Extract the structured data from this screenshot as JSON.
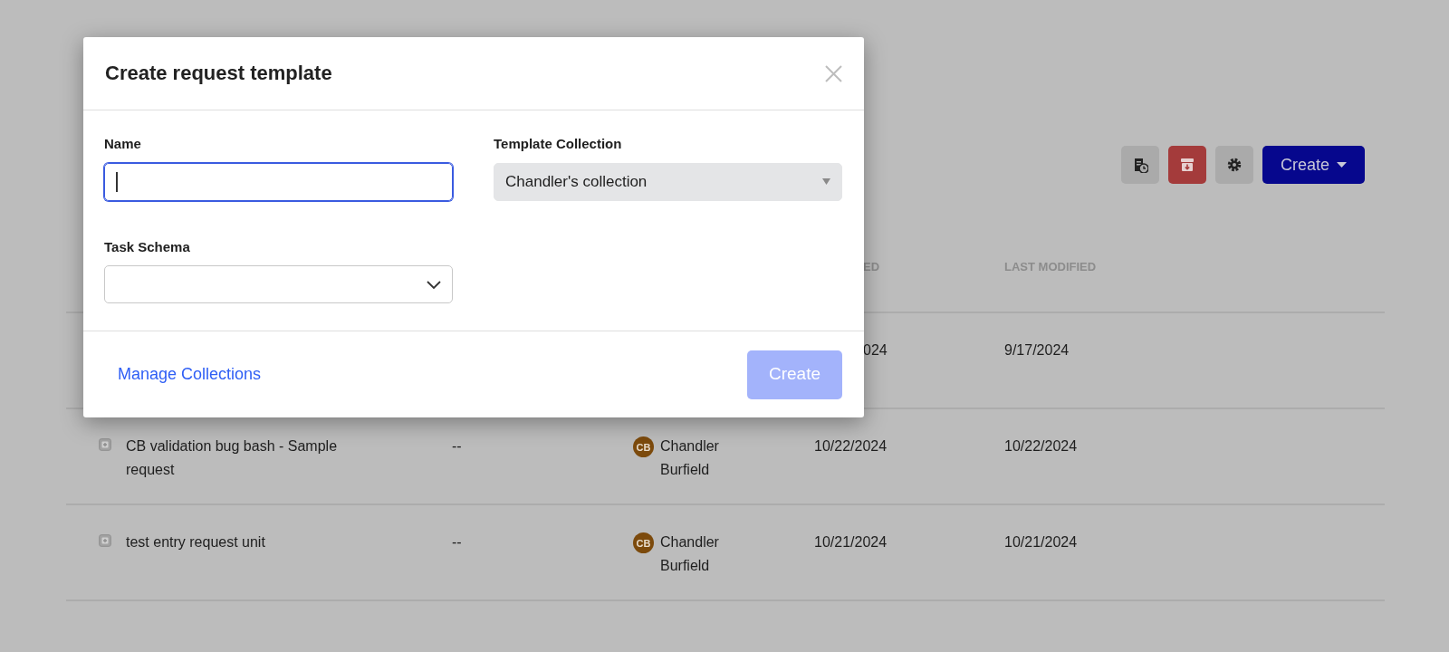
{
  "toolbar": {
    "create_button": {
      "label": "Create"
    }
  },
  "table": {
    "headers": [
      {
        "label": "ED"
      },
      {
        "label": "LAST MODIFIED"
      }
    ],
    "rows": [
      {
        "created": "024",
        "last_modified": "9/17/2024"
      },
      {
        "name": "CB validation bug bash - Sample request",
        "column_2": "--",
        "owner": {
          "initials": "CB",
          "name": "Chandler Burfield"
        },
        "created": "10/22/2024",
        "last_modified": "10/22/2024"
      },
      {
        "name": "test entry request unit",
        "column_2": "--",
        "owner": {
          "initials": "CB",
          "name": "Chandler Burfield"
        },
        "created": "10/21/2024",
        "last_modified": "10/21/2024"
      }
    ]
  },
  "modal": {
    "title": "Create request template",
    "fields": [
      {
        "kind": "text",
        "label": "Name",
        "focused": true
      },
      {
        "kind": "select",
        "label": "Template Collection",
        "value": "Chandler's collection",
        "disabled": true
      },
      {
        "kind": "select",
        "label": "Task Schema",
        "disabled": false
      }
    ],
    "link": "Manage Collections",
    "submit": {
      "label": "Create",
      "disabled": true
    }
  }
}
